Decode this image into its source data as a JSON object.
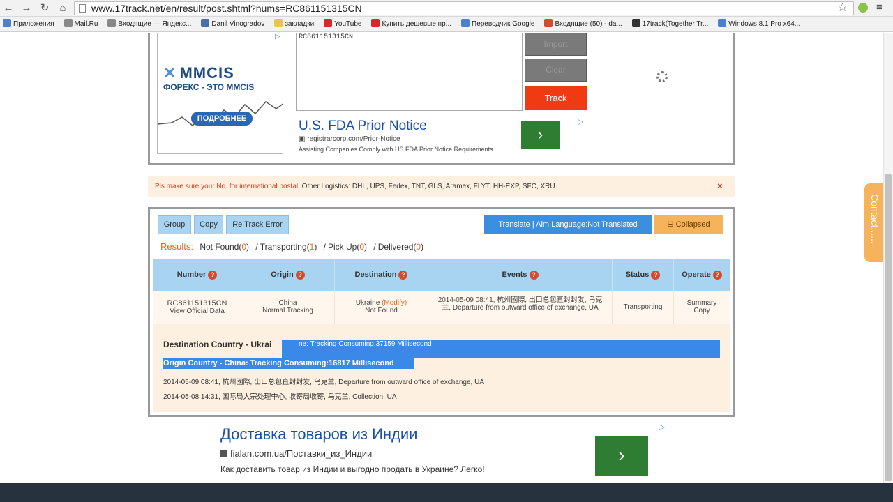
{
  "browser": {
    "url": "www.17track.net/en/result/post.shtml?nums=RC861151315CN",
    "bookmarks": [
      {
        "label": "Приложения",
        "color": "#4a7fd1"
      },
      {
        "label": "Mail.Ru",
        "color": "#888888"
      },
      {
        "label": "Входящие — Яндекс...",
        "color": "#888888"
      },
      {
        "label": "Danil Vinogradov",
        "color": "#4a6ea8"
      },
      {
        "label": "закладки",
        "color": "#e8c64a"
      },
      {
        "label": "YouTube",
        "color": "#d62a2a"
      },
      {
        "label": "Купить дешевые пр...",
        "color": "#d62a2a"
      },
      {
        "label": "Переводчик Google",
        "color": "#4a7fd1"
      },
      {
        "label": "Входящие (50) - da...",
        "color": "#d64a2a"
      },
      {
        "label": "17track(Together Tr...",
        "color": "#333333"
      },
      {
        "label": "Windows 8.1 Pro x64...",
        "color": "#4a7fd1"
      }
    ]
  },
  "ad_top": {
    "logo": "MMCIS",
    "tagline": "ФОРЕКС - ЭТО MMCIS",
    "button": "ПОДРОБНЕЕ"
  },
  "tracking_input": {
    "value": "RC861151315CN",
    "import_label": "Import",
    "clear_label": "Clear",
    "track_label": "Track"
  },
  "ad_fda": {
    "title": "U.S. FDA Prior Notice",
    "url": "registrarcorp.com/Prior-Notice",
    "description": "Assisting Companies Comply with US FDA Prior Notice Requirements",
    "arrow": "›"
  },
  "notice": {
    "warning": "Pls make sure your No. for international postal,",
    "rest": " Other Logistics: DHL, UPS, Fedex, TNT, GLS, Aramex, FLYT, HH-EXP, SFC, XRU",
    "close": "×"
  },
  "results_toolbar": {
    "group_label": "Group",
    "copy_label": "Copy",
    "retrack_label": "Re Track Error",
    "translate_label": "Translate | Aim Language:Not Translated",
    "collapsed_label": "Collapsed"
  },
  "summary": {
    "results_label": "Results:",
    "not_found_label": "Not Found(",
    "not_found": "0",
    "transporting_label": "Transporting(",
    "transporting": "1",
    "pickup_label": "Pick Up(",
    "pickup": "0",
    "delivered_label": "Delivered(",
    "delivered": "0",
    "close_paren": ")",
    "separator": "/"
  },
  "table": {
    "headers": [
      "Number",
      "Origin",
      "Destination",
      "Events",
      "Status",
      "Operate"
    ],
    "row": {
      "number": "RC861151315CN",
      "view_official": "View Official Data",
      "origin_country": "China",
      "origin_status": "Normal Tracking",
      "destination_country": "Ukraine",
      "modify": "(Modify)",
      "destination_status": "Not Found",
      "event": "2014-05-09 08:41, 杭州國際, 出口总包直封封发, 乌克兰, Departure from outward office of exchange, UA",
      "status": "Transporting",
      "operate_summary": "Summary",
      "operate_copy": "Copy"
    }
  },
  "details": {
    "destination_prefix": "Destination Country - Ukrai",
    "destination_highlight": "ne: Tracking Consuming:37159 Millisecond",
    "origin_line": "Origin Country - China: Tracking Consuming:16817 Millisecond",
    "events": [
      "2014-05-09 08:41, 杭州國際, 出口总包直封封发, 乌克兰, Departure from outward office of exchange, UA",
      "2014-05-08 14:31, 国际局大宗处理中心, 收寄局收寄, 乌克兰, Collection, UA"
    ]
  },
  "ad_bottom": {
    "title": "Доставка товаров из Индии",
    "url": "fialan.com.ua/Поставки_из_Индии",
    "description": "Как доставить товар из Индии и выгодно продать в Украине? Легко!",
    "arrow": "›"
  },
  "contact_tab": "Contact......"
}
